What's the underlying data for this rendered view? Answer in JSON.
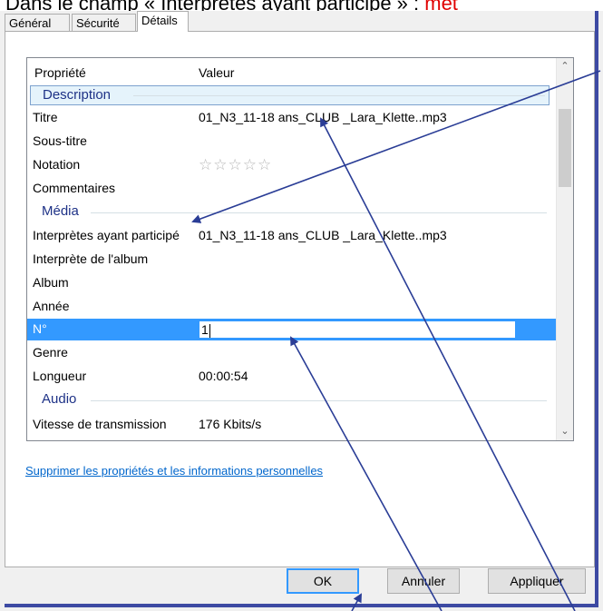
{
  "caption": {
    "prefix": "Dans le champ « Interprètes ayant participé » : ",
    "highlight": "met"
  },
  "tabs": [
    {
      "label": "Général"
    },
    {
      "label": "Sécurité"
    },
    {
      "label": "Détails"
    }
  ],
  "list": {
    "headers": {
      "property": "Propriété",
      "value": "Valeur"
    },
    "groups": {
      "description": "Description",
      "media": "Média",
      "audio": "Audio"
    },
    "rows": {
      "titre": {
        "key": "Titre",
        "value": "01_N3_11-18 ans_CLUB _Lara_Klette..mp3"
      },
      "soustitre": {
        "key": "Sous-titre",
        "value": ""
      },
      "notation": {
        "key": "Notation",
        "value": "☆☆☆☆☆"
      },
      "commentaires": {
        "key": "Commentaires",
        "value": ""
      },
      "interpretes": {
        "key": "Interprètes ayant participé",
        "value": "01_N3_11-18 ans_CLUB _Lara_Klette..mp3"
      },
      "interprete_album": {
        "key": "Interprète de l'album",
        "value": ""
      },
      "album": {
        "key": "Album",
        "value": ""
      },
      "annee": {
        "key": "Année",
        "value": ""
      },
      "numero": {
        "key": "N°",
        "value": "1"
      },
      "genre": {
        "key": "Genre",
        "value": ""
      },
      "longueur": {
        "key": "Longueur",
        "value": "00:00:54"
      },
      "vitesse": {
        "key": "Vitesse de transmission",
        "value": "176 Kbits/s"
      }
    }
  },
  "link": "Supprimer les propriétés et les informations personnelles",
  "buttons": {
    "ok": "OK",
    "cancel": "Annuler",
    "apply": "Appliquer"
  },
  "colors": {
    "arrow": "#2a3d96",
    "frame": "#3d4aa3",
    "highlight": "#e00000"
  }
}
